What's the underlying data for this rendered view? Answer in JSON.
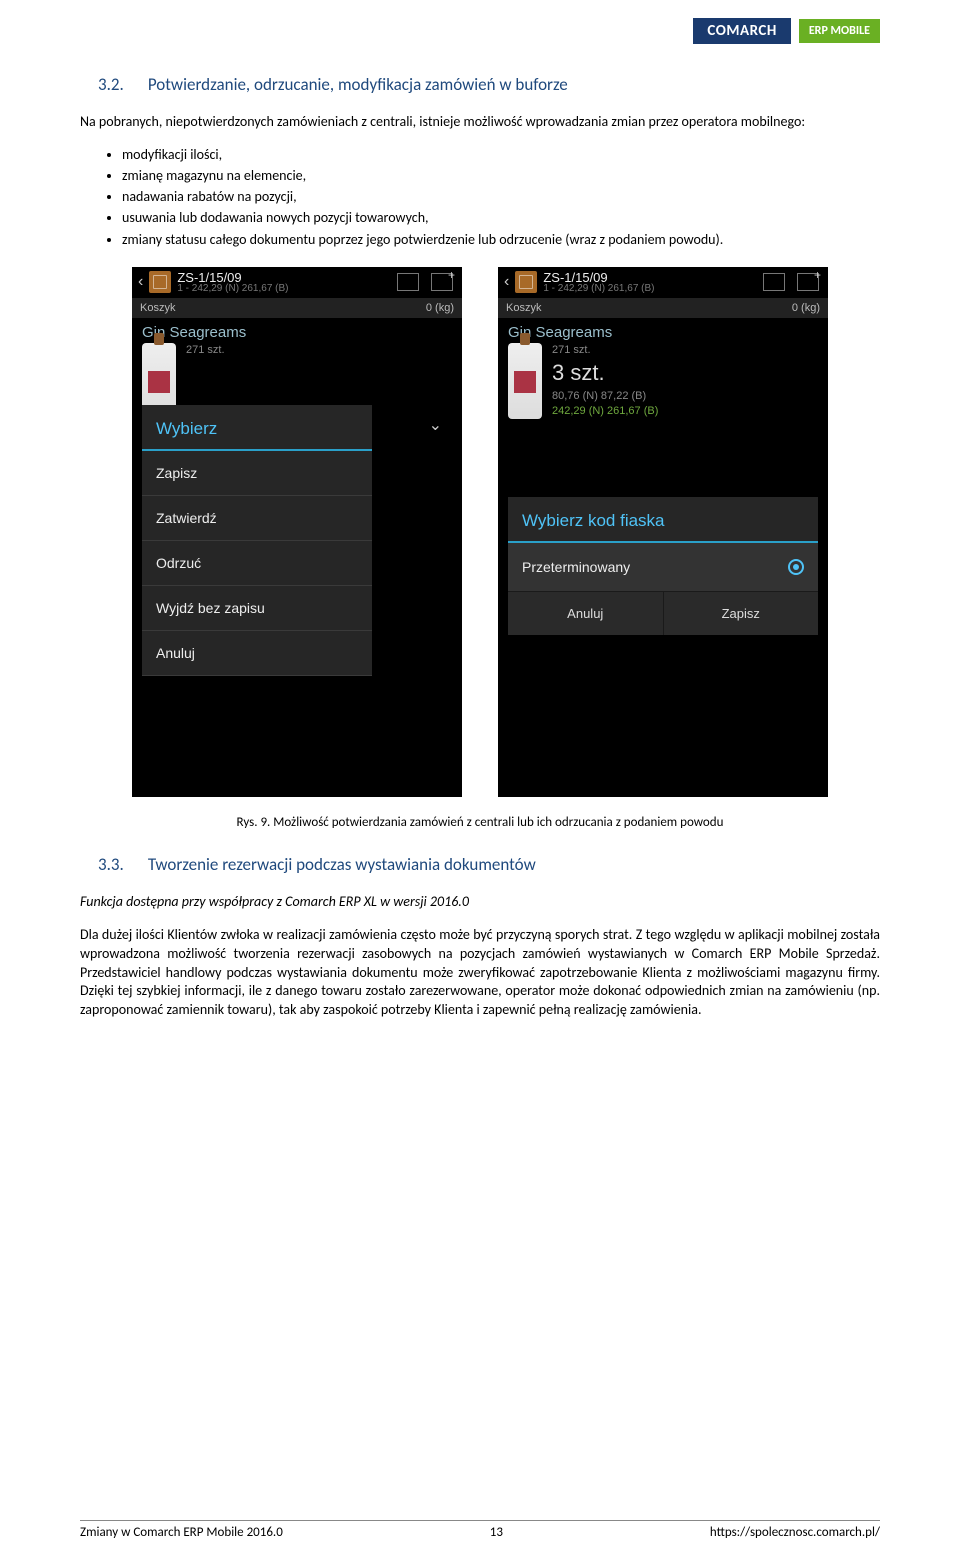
{
  "header": {
    "brand": "COMARCH",
    "product": "ERP MOBILE"
  },
  "section32": {
    "num": "3.2.",
    "title": "Potwierdzanie, odrzucanie, modyfikacja zamówień w buforze",
    "intro": "Na pobranych, niepotwierdzonych zamówieniach z centrali, istnieje możliwość wprowadzania zmian przez operatora mobilnego:",
    "bullets": [
      "modyfikacji ilości,",
      "zmianę magazynu na elemencie,",
      "nadawania rabatów na pozycji,",
      "usuwania lub dodawania nowych pozycji towarowych,",
      "zmiany statusu całego dokumentu poprzez jego potwierdzenie lub odrzucenie (wraz z podaniem powodu)."
    ]
  },
  "screenshot_common": {
    "doc_no": "ZS-1/15/09",
    "doc_sub": "1 - 242,29 (N) 261,67 (B)",
    "basket_label": "Koszyk",
    "basket_value": "0 (kg)",
    "product_name": "Gin Seagreams",
    "stock": "271 szt."
  },
  "screenshot_left": {
    "dialog_title": "Wybierz",
    "options": [
      "Zapisz",
      "Zatwierdź",
      "Odrzuć",
      "Wyjdź bez zapisu",
      "Anuluj"
    ]
  },
  "screenshot_right": {
    "qty": "3 szt.",
    "price1": "80,76 (N) 87,22 (B)",
    "price2": "242,29 (N) 261,67 (B)",
    "dialog_title": "Wybierz kod fiaska",
    "option": "Przeterminowany",
    "btn_cancel": "Anuluj",
    "btn_save": "Zapisz"
  },
  "caption": "Rys. 9. Możliwość potwierdzania zamówień z centrali lub ich odrzucania z podaniem powodu",
  "section33": {
    "num": "3.3.",
    "title": "Tworzenie rezerwacji podczas wystawiania dokumentów",
    "note": "Funkcja dostępna przy współpracy z Comarch ERP XL w wersji 2016.0",
    "body": "Dla dużej ilości Klientów zwłoka w realizacji zamówienia często może być przyczyną sporych strat. Z tego względu w aplikacji mobilnej została wprowadzona możliwość tworzenia rezerwacji zasobowych na pozycjach zamówień wystawianych w Comarch ERP Mobile Sprzedaż. Przedstawiciel handlowy podczas wystawiania dokumentu może zweryfikować zapotrzebowanie Klienta z możliwościami magazynu firmy. Dzięki tej szybkiej informacji, ile z danego towaru zostało zarezerwowane, operator może dokonać odpowiednich zmian na zamówieniu (np. zaproponować zamiennik towaru), tak aby zaspokoić potrzeby Klienta i zapewnić pełną realizację zamówienia."
  },
  "footer": {
    "left": "Zmiany w Comarch ERP Mobile 2016.0",
    "page": "13",
    "right": "https://spolecznosc.comarch.pl/"
  }
}
